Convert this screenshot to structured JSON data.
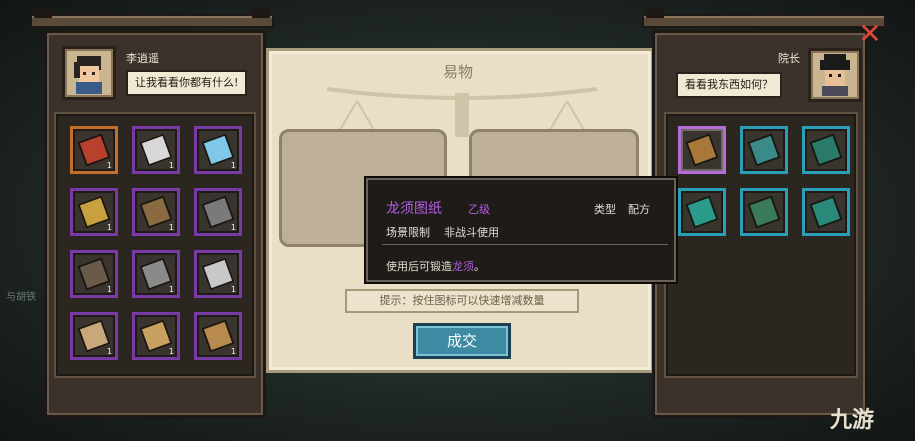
{
  "left_panel": {
    "name": "李逍遥",
    "speech": "让我看看你都有什么!",
    "items": [
      {
        "icon": "treasure-chest-icon",
        "count": "1",
        "frame": "gold",
        "color": "#b8412e"
      },
      {
        "icon": "sword-blade-icon",
        "count": "1",
        "frame": "purple",
        "color": "#d8d8d8"
      },
      {
        "icon": "blue-gem-icon",
        "count": "1",
        "frame": "purple",
        "color": "#7fc8e8"
      },
      {
        "icon": "gold-ornament-icon",
        "count": "1",
        "frame": "purple",
        "color": "#c8a040"
      },
      {
        "icon": "bronze-plate-icon",
        "count": "1",
        "frame": "purple",
        "color": "#8a6a40"
      },
      {
        "icon": "grey-stone-icon",
        "count": "1",
        "frame": "purple",
        "color": "#7a7a7a"
      },
      {
        "icon": "clay-jar-icon",
        "count": "1",
        "frame": "purple",
        "color": "#6a5a48"
      },
      {
        "icon": "iron-bar-icon",
        "count": "1",
        "frame": "purple",
        "color": "#8a8a8a"
      },
      {
        "icon": "silver-key-icon",
        "count": "1",
        "frame": "purple",
        "color": "#c8c8c8"
      },
      {
        "icon": "scroll-icon",
        "count": "1",
        "frame": "purple",
        "color": "#c8a878"
      },
      {
        "icon": "pattern-paper-icon",
        "count": "1",
        "frame": "purple",
        "color": "#c8a060"
      },
      {
        "icon": "blueprint-paper-icon",
        "count": "1",
        "frame": "purple",
        "color": "#b88a50"
      }
    ]
  },
  "right_panel": {
    "name": "院长",
    "speech": "看看我东西如何？",
    "items": [
      {
        "icon": "brush-scroll-icon",
        "count": "",
        "frame": "purple",
        "color": "#a8783a",
        "selected": true
      },
      {
        "icon": "green-book-icon",
        "count": "",
        "frame": "teal",
        "color": "#3a8a8a"
      },
      {
        "icon": "green-book-icon",
        "count": "",
        "frame": "teal",
        "color": "#2a7a6a"
      },
      {
        "icon": "green-book-icon",
        "count": "",
        "frame": "teal",
        "color": "#2a9a8a"
      },
      {
        "icon": "green-book-icon",
        "count": "",
        "frame": "teal",
        "color": "#3a7a5a"
      },
      {
        "icon": "green-book-icon",
        "count": "",
        "frame": "teal",
        "color": "#2a8a7a"
      }
    ]
  },
  "center": {
    "title": "易物",
    "hint": "提示：按住图标可以快速增减数量",
    "deal_button": "成交"
  },
  "tooltip": {
    "name": "龙须图纸",
    "grade": "乙级",
    "type_label": "类型",
    "type_value": "配方",
    "scene_label": "场景限制",
    "scene_value": "非战斗使用",
    "desc_prefix": "使用后可锻造",
    "desc_highlight": "龙须",
    "desc_suffix": "。"
  },
  "faint_left_text": "与胡铁",
  "watermark": "九游",
  "colors": {
    "rare_purple": "#b25ee0",
    "button_teal": "#3f8aa3",
    "close_red": "#d9483b"
  }
}
